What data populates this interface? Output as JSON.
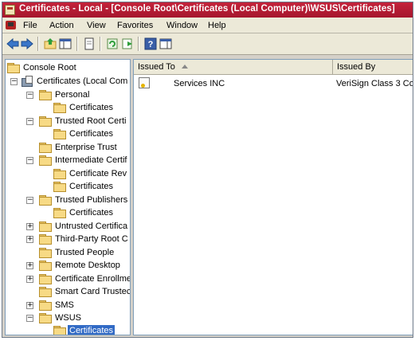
{
  "window": {
    "title": "Certificates - Local - [Console Root\\Certificates (Local Computer)\\WSUS\\Certificates]"
  },
  "menu": [
    "File",
    "Action",
    "View",
    "Favorites",
    "Window",
    "Help"
  ],
  "toolbar": {
    "icons": [
      "back-icon",
      "forward-icon",
      "up-folder-icon",
      "show-hide-tree-icon",
      "properties-icon",
      "refresh-icon",
      "export-list-icon",
      "help-icon",
      "action-pane-icon"
    ]
  },
  "tree": {
    "root": "Console Root",
    "certificates_node": "Certificates (Local Com",
    "items": [
      "Personal",
      "Certificates",
      "Trusted Root Certi",
      "Certificates",
      "Enterprise Trust",
      "Intermediate Certif",
      "Certificate Rev",
      "Certificates",
      "Trusted Publishers",
      "Certificates",
      "Untrusted Certifica",
      "Third-Party Root C",
      "Trusted People",
      "Remote Desktop",
      "Certificate Enrollme",
      "Smart Card Trustec",
      "SMS",
      "WSUS",
      "Certificates"
    ],
    "selected": "Certificates"
  },
  "list": {
    "columns": [
      "Issued To",
      "Issued By"
    ],
    "rows": [
      {
        "issued_to": "Services INC",
        "issued_by": "VeriSign Class 3 Co"
      }
    ]
  },
  "colors": {
    "titlebar": "#b01c34",
    "selection": "#316ac5",
    "folder": "#f7da85"
  }
}
